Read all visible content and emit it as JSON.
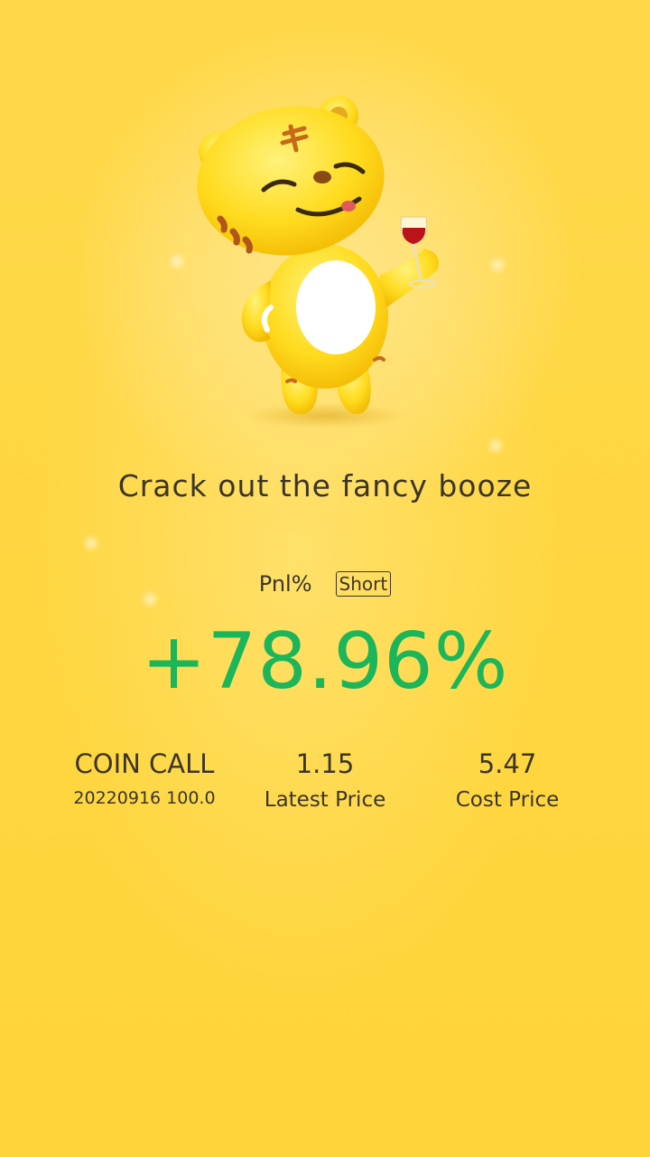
{
  "tagline": "Crack out the fancy booze",
  "pnl": {
    "label": "Pnl%",
    "direction": "Short",
    "value": "+78.96%",
    "value_color": "#1bb55a"
  },
  "stats": [
    {
      "value": "COIN CALL",
      "label": "20220916 100.0"
    },
    {
      "value": "1.15",
      "label": "Latest Price"
    },
    {
      "value": "5.47",
      "label": "Cost Price"
    }
  ],
  "colors": {
    "background": "#ffd73c",
    "text": "#3b3528",
    "positive": "#1bb55a"
  },
  "icons": {
    "mascot": "tiger-mascot-with-wine-glass"
  }
}
